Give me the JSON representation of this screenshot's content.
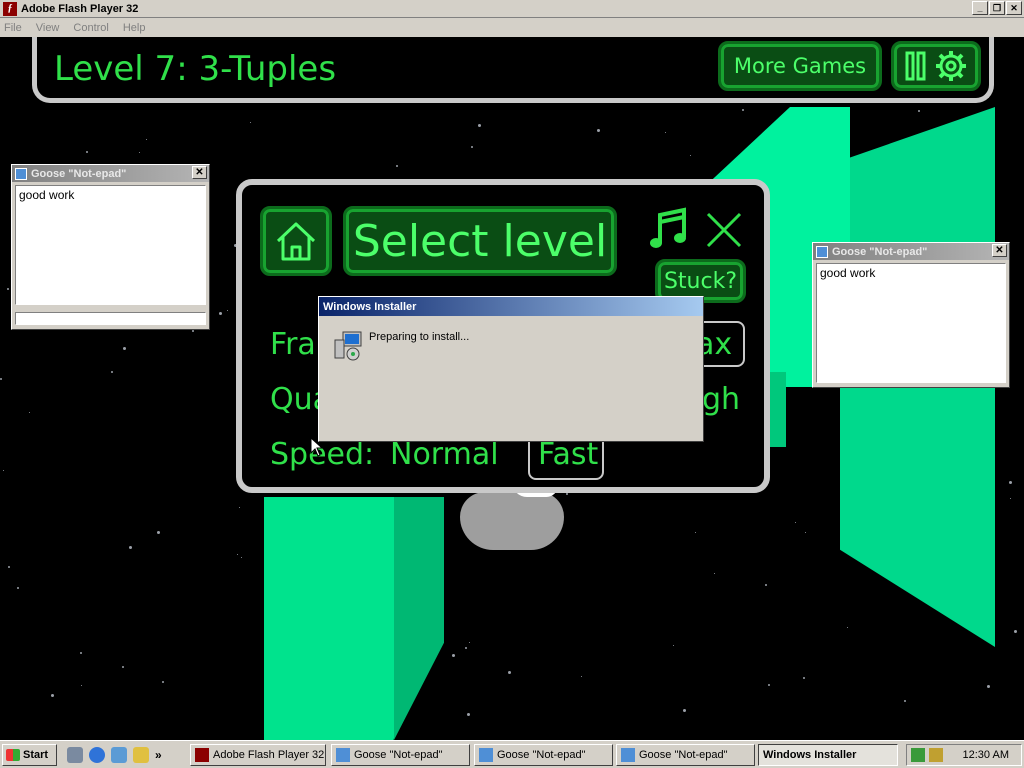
{
  "window": {
    "title": "Adobe Flash Player 32",
    "menu": [
      "File",
      "View",
      "Control",
      "Help"
    ],
    "buttons": [
      "_",
      "❐",
      "✕"
    ]
  },
  "game": {
    "level_title": "Level 7: 3-Tuples",
    "more_games_label": "More Games",
    "select_level_label": "Select level",
    "stuck_label": "Stuck?",
    "settings": {
      "frame_label_partial": "Fran",
      "frame_value_partial": "ax",
      "quality_label_partial": "Qua",
      "quality_value_partial": "gh",
      "speed_label": "Speed:",
      "speed_normal": "Normal",
      "speed_fast": "Fast"
    },
    "accent_color": "#30e04a"
  },
  "notepads": [
    {
      "title": "Goose \"Not-epad\"",
      "text": "good work"
    },
    {
      "title": "Goose \"Not-epad\"",
      "text": "good work"
    }
  ],
  "installer": {
    "title": "Windows Installer",
    "message": "Preparing to install..."
  },
  "taskbar": {
    "start_label": "Start",
    "more_label": "»",
    "tasks": [
      {
        "label": "Adobe Flash Player 32",
        "icon": "flash-icon"
      },
      {
        "label": "Goose \"Not-epad\"",
        "icon": "notepad-icon"
      },
      {
        "label": "Goose \"Not-epad\"",
        "icon": "notepad-icon"
      },
      {
        "label": "Goose \"Not-epad\"",
        "icon": "notepad-icon"
      },
      {
        "label": "Windows Installer",
        "icon": "installer-icon",
        "active": true
      }
    ],
    "clock": "12:30 AM"
  }
}
